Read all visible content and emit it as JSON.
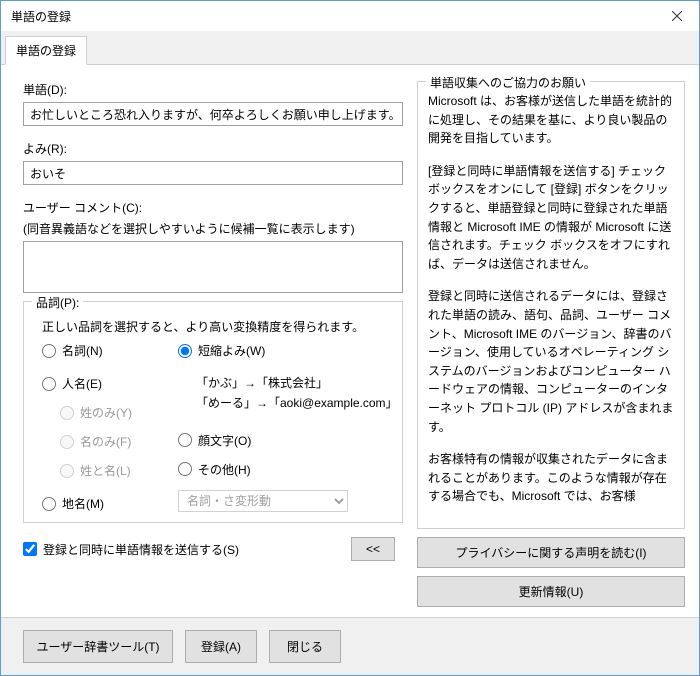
{
  "titlebar": {
    "title": "単語の登録"
  },
  "tab": {
    "label": "単語の登録"
  },
  "left": {
    "word_label": "単語(D):",
    "word_value": "お忙しいところ恐れ入りますが、何卒よろしくお願い申し上げます。",
    "yomi_label": "よみ(R):",
    "yomi_value": "おいそ",
    "comment_label": "ユーザー コメント(C):",
    "comment_hint": "(同音異義語などを選択しやすいように候補一覧に表示します)",
    "comment_value": "",
    "pos_legend": "品詞(P):",
    "pos_hint": "正しい品詞を選択すると、より高い変換精度を得られます。",
    "radios": {
      "noun": "名詞(N)",
      "person": "人名(E)",
      "surname": "姓のみ(Y)",
      "given": "名のみ(F)",
      "both": "姓と名(L)",
      "place": "地名(M)",
      "abbrev": "短縮よみ(W)",
      "emoji": "顔文字(O)",
      "other": "その他(H)"
    },
    "examples": {
      "line1": "「かぶ」→「株式会社」",
      "line2": "「めーる」→「aoki@example.com」"
    },
    "select_value": "名詞・さ変形動",
    "send_checkbox": "登録と同時に単語情報を送信する(S)",
    "collapse_btn": "<<"
  },
  "right": {
    "legend": "単語収集へのご協力のお願い",
    "p1": "Microsoft は、お客様が送信した単語を統計的に処理し、その結果を基に、より良い製品の開発を目指しています。",
    "p2": "[登録と同時に単語情報を送信する] チェック ボックスをオンにして [登録] ボタンをクリックすると、単語登録と同時に登録された単語情報と Microsoft IME の情報が Microsoft に送信されます。チェック ボックスをオフにすれば、データは送信されません。",
    "p3": "登録と同時に送信されるデータには、登録された単語の読み、語句、品詞、ユーザー コメント、Microsoft IME のバージョン、辞書のバージョン、使用しているオペレーティング システムのバージョンおよびコンピューター ハードウェアの情報、コンピューターのインターネット プロトコル (IP) アドレスが含まれます。",
    "p4": "お客様特有の情報が収集されたデータに含まれることがあります。このような情報が存在する場合でも、Microsoft では、お客様",
    "privacy_btn": "プライバシーに関する声明を読む(I)",
    "update_btn": "更新情報(U)"
  },
  "footer": {
    "dict_tool": "ユーザー辞書ツール(T)",
    "register": "登録(A)",
    "close": "閉じる"
  }
}
